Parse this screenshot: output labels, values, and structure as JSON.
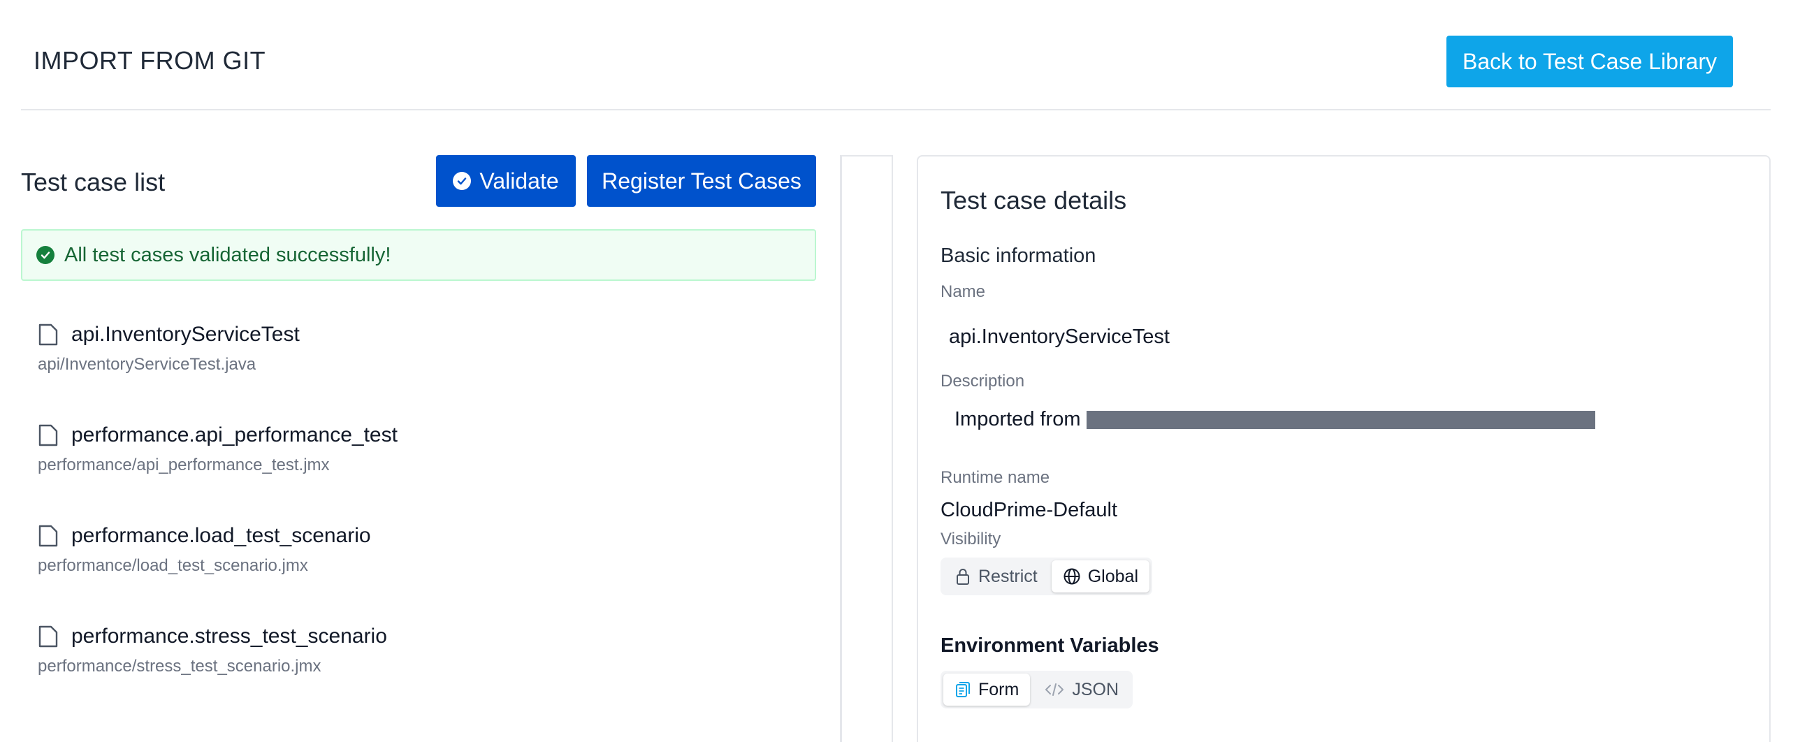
{
  "header": {
    "title": "IMPORT FROM GIT",
    "back_label": "Back to Test Case Library"
  },
  "left": {
    "title": "Test case list",
    "validate_label": "Validate",
    "register_label": "Register Test Cases",
    "alert_text": "All test cases validated successfully!",
    "items": [
      {
        "name": "api.InventoryServiceTest",
        "path": "api/InventoryServiceTest.java"
      },
      {
        "name": "performance.api_performance_test",
        "path": "performance/api_performance_test.jmx"
      },
      {
        "name": "performance.load_test_scenario",
        "path": "performance/load_test_scenario.jmx"
      },
      {
        "name": "performance.stress_test_scenario",
        "path": "performance/stress_test_scenario.jmx"
      }
    ]
  },
  "details": {
    "title": "Test case details",
    "basic_info": "Basic information",
    "name_label": "Name",
    "name_value": "api.InventoryServiceTest",
    "description_label": "Description",
    "description_value": "Imported from",
    "runtime_label": "Runtime name",
    "runtime_value": "CloudPrime-Default",
    "visibility_label": "Visibility",
    "visibility_options": [
      "Restrict",
      "Global"
    ],
    "visibility_selected": "Global",
    "env_title": "Environment Variables",
    "env_modes": [
      "Form",
      "JSON"
    ],
    "env_selected": "Form"
  },
  "colors": {
    "accent_sky": "#0ea5e9",
    "primary_blue": "#0052cc",
    "success_green": "#15803d"
  }
}
